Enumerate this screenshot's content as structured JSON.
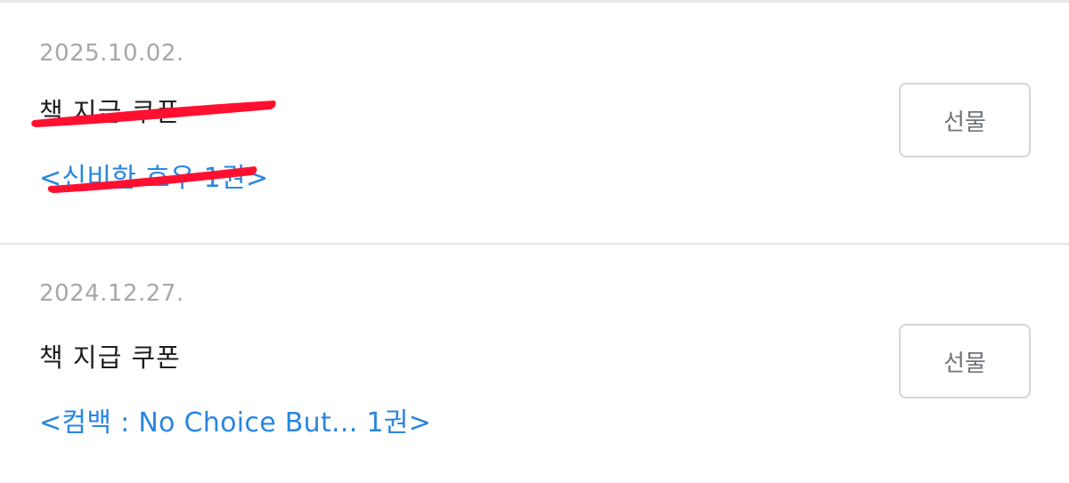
{
  "coupons": [
    {
      "date": "2025.10.02.",
      "title": "책 지급 쿠폰",
      "book": "<신비한 호우 1권>",
      "gift_label": "선물"
    },
    {
      "date": "2024.12.27.",
      "title": "책 지급 쿠폰",
      "book": "<컴백 : No Choice But... 1권>",
      "gift_label": "선물"
    }
  ],
  "colors": {
    "link": "#2a86e0",
    "date": "#a4a8ae",
    "redaction": "#ff1030"
  }
}
